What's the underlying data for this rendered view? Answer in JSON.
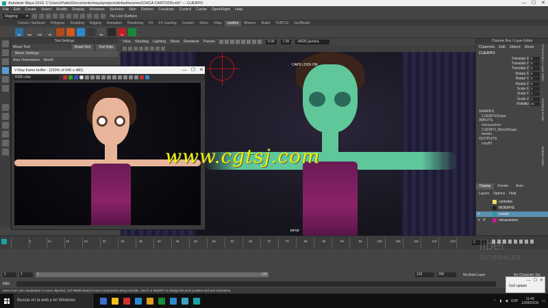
{
  "window": {
    "title": "Autodesk Maya 2016: C:\\Users\\Pablo\\Documents\\maya\\projects\\default\\scenes\\CHICA CARTOON.mb* --- CUERPO",
    "controls": [
      "—",
      "☐",
      "✕"
    ]
  },
  "menubar": {
    "items": [
      "File",
      "Edit",
      "Create",
      "Select",
      "Modify",
      "Display",
      "Windows",
      "Skeleton",
      "Skin",
      "Deform",
      "Constrain",
      "Control",
      "Cache",
      "OpenFlight",
      "Help"
    ]
  },
  "statusline": {
    "mode": "Rigging",
    "live_surface": "No Live Surface"
  },
  "shelf": {
    "tabs": [
      "Curves / Surfaces",
      "Polygons",
      "Sculpting",
      "Rigging",
      "Animation",
      "Rendering",
      "FX",
      "FX Caching",
      "Custom",
      "XGen",
      "VRay",
      "vostrov",
      "Mixamo",
      "Bullet",
      "TURTLE",
      "GoZBrush"
    ],
    "active_tab": "vostrov",
    "buttons": [
      {
        "label": "vto",
        "color": "#2a6fa0"
      },
      {
        "label": "rndr",
        "color": "#4a4a4a"
      },
      {
        "label": "rndr",
        "color": "#4a4a4a"
      },
      {
        "label": "vfb",
        "color": "#4a4a4a"
      },
      {
        "label": "",
        "color": "#b24a1a"
      },
      {
        "label": "",
        "color": "#d05a1a"
      },
      {
        "label": "",
        "color": "#2a8ad0"
      },
      {
        "label": "",
        "color": "#3a3a3a"
      },
      {
        "label": "ser",
        "color": "#505050"
      },
      {
        "label": "",
        "color": "#2a2a2a"
      },
      {
        "label": "vrl",
        "color": "#c02020"
      },
      {
        "label": "",
        "color": "#1a8a3a"
      }
    ]
  },
  "tool_settings": {
    "panel_title": "Tool Settings",
    "tool_name": "Move Tool",
    "reset_label": "Reset Tool",
    "help_label": "Tool Help",
    "section": "Move Settings",
    "axis_label": "Axis Orientation:",
    "axis_value": "World"
  },
  "viewport": {
    "menus": [
      "View",
      "Shading",
      "Lighting",
      "Show",
      "Renderer",
      "Panels"
    ],
    "near_value": "0.00",
    "far_value": "1.00",
    "color_space": "sRGB gamma",
    "caps_lock": "CAPS LOCK ON",
    "camera": "persp"
  },
  "vray_buffer": {
    "title": "V-Ray frame buffer - [100% of 640 x 480]",
    "channel": "RGB color",
    "controls": [
      "—",
      "☐",
      "✕"
    ]
  },
  "channel_box": {
    "panel_title": "Channel Box / Layer Editor",
    "menus": [
      "Channels",
      "Edit",
      "Object",
      "Show"
    ],
    "object": "CUERPO",
    "attributes": [
      {
        "name": "Translate X",
        "value": "0"
      },
      {
        "name": "Translate Y",
        "value": "0"
      },
      {
        "name": "Translate Z",
        "value": "0"
      },
      {
        "name": "Rotate X",
        "value": "0"
      },
      {
        "name": "Rotate Y",
        "value": "0"
      },
      {
        "name": "Rotate Z",
        "value": "0"
      },
      {
        "name": "Scale X",
        "value": "1"
      },
      {
        "name": "Scale Y",
        "value": "1"
      },
      {
        "name": "Scale Z",
        "value": "1"
      },
      {
        "name": "Visibility",
        "value": "on"
      }
    ],
    "shapes_title": "SHAPES",
    "shapes": [
      "CUERPOShape"
    ],
    "inputs_title": "INPUTS",
    "inputs": [
      "chicacartoon",
      "CUERPO_BlendShape",
      "tweak1"
    ],
    "outputs_title": "OUTPUTS",
    "outputs": [
      "vrayBT"
    ],
    "side_tabs": [
      "Channel Box / Layer Editor",
      "Modeling Toolkit",
      "Attribute Editor"
    ]
  },
  "layer_editor": {
    "tabs": [
      "Display",
      "Render",
      "Anim"
    ],
    "active_tab": "Display",
    "menus": [
      "Layers",
      "Options",
      "Help"
    ],
    "layers": [
      {
        "v": "",
        "p": "",
        "name": "controles",
        "color": "#e8e060",
        "selected": false
      },
      {
        "v": "",
        "p": "",
        "name": "MOBIPHS",
        "color": "#202020",
        "selected": false
      },
      {
        "v": "V",
        "p": "",
        "name": "cuerpo",
        "color": "#2a9a9a",
        "selected": true
      },
      {
        "v": "V",
        "p": "P",
        "name": "chicacartoon",
        "color": "#c020a0",
        "selected": false
      }
    ]
  },
  "timeline": {
    "ticks": [
      "5",
      "10",
      "15",
      "20",
      "25",
      "30",
      "35",
      "40",
      "45",
      "50",
      "55",
      "60",
      "65",
      "70",
      "75",
      "80",
      "85",
      "90",
      "95",
      "100",
      "105",
      "110",
      "115",
      "120"
    ],
    "current_frame": "1"
  },
  "range": {
    "start": "1",
    "start2": "1",
    "slider_end": "120",
    "end": "120",
    "end2": "200",
    "anim_layer": "No Anim Layer",
    "char_set": "No Character Set"
  },
  "cmdline": {
    "label": "MEL",
    "help": "Move Tool: Use manipulator to move object(s). Ctrl+MMB+drag to move components along normals. Use D or INSERT to change the pivot position and axis orientation."
  },
  "taskbar": {
    "search": "Buscar en la web y en Windows",
    "icons": [
      "#3a6fd0",
      "#f0c020",
      "#d03030",
      "#2a8ad0",
      "#e0a020",
      "#1a8a3a",
      "#2a8ad0",
      "#40a0c0",
      "#1aa3a3"
    ],
    "lang": "ESP",
    "time": "11:43",
    "date": "12/06/2016"
  },
  "notification": {
    "label": "Go2 update"
  },
  "watermark": {
    "site": "www.cgtsj.com",
    "brand": "libel",
    "brand_sub": "TUTORIALES"
  }
}
